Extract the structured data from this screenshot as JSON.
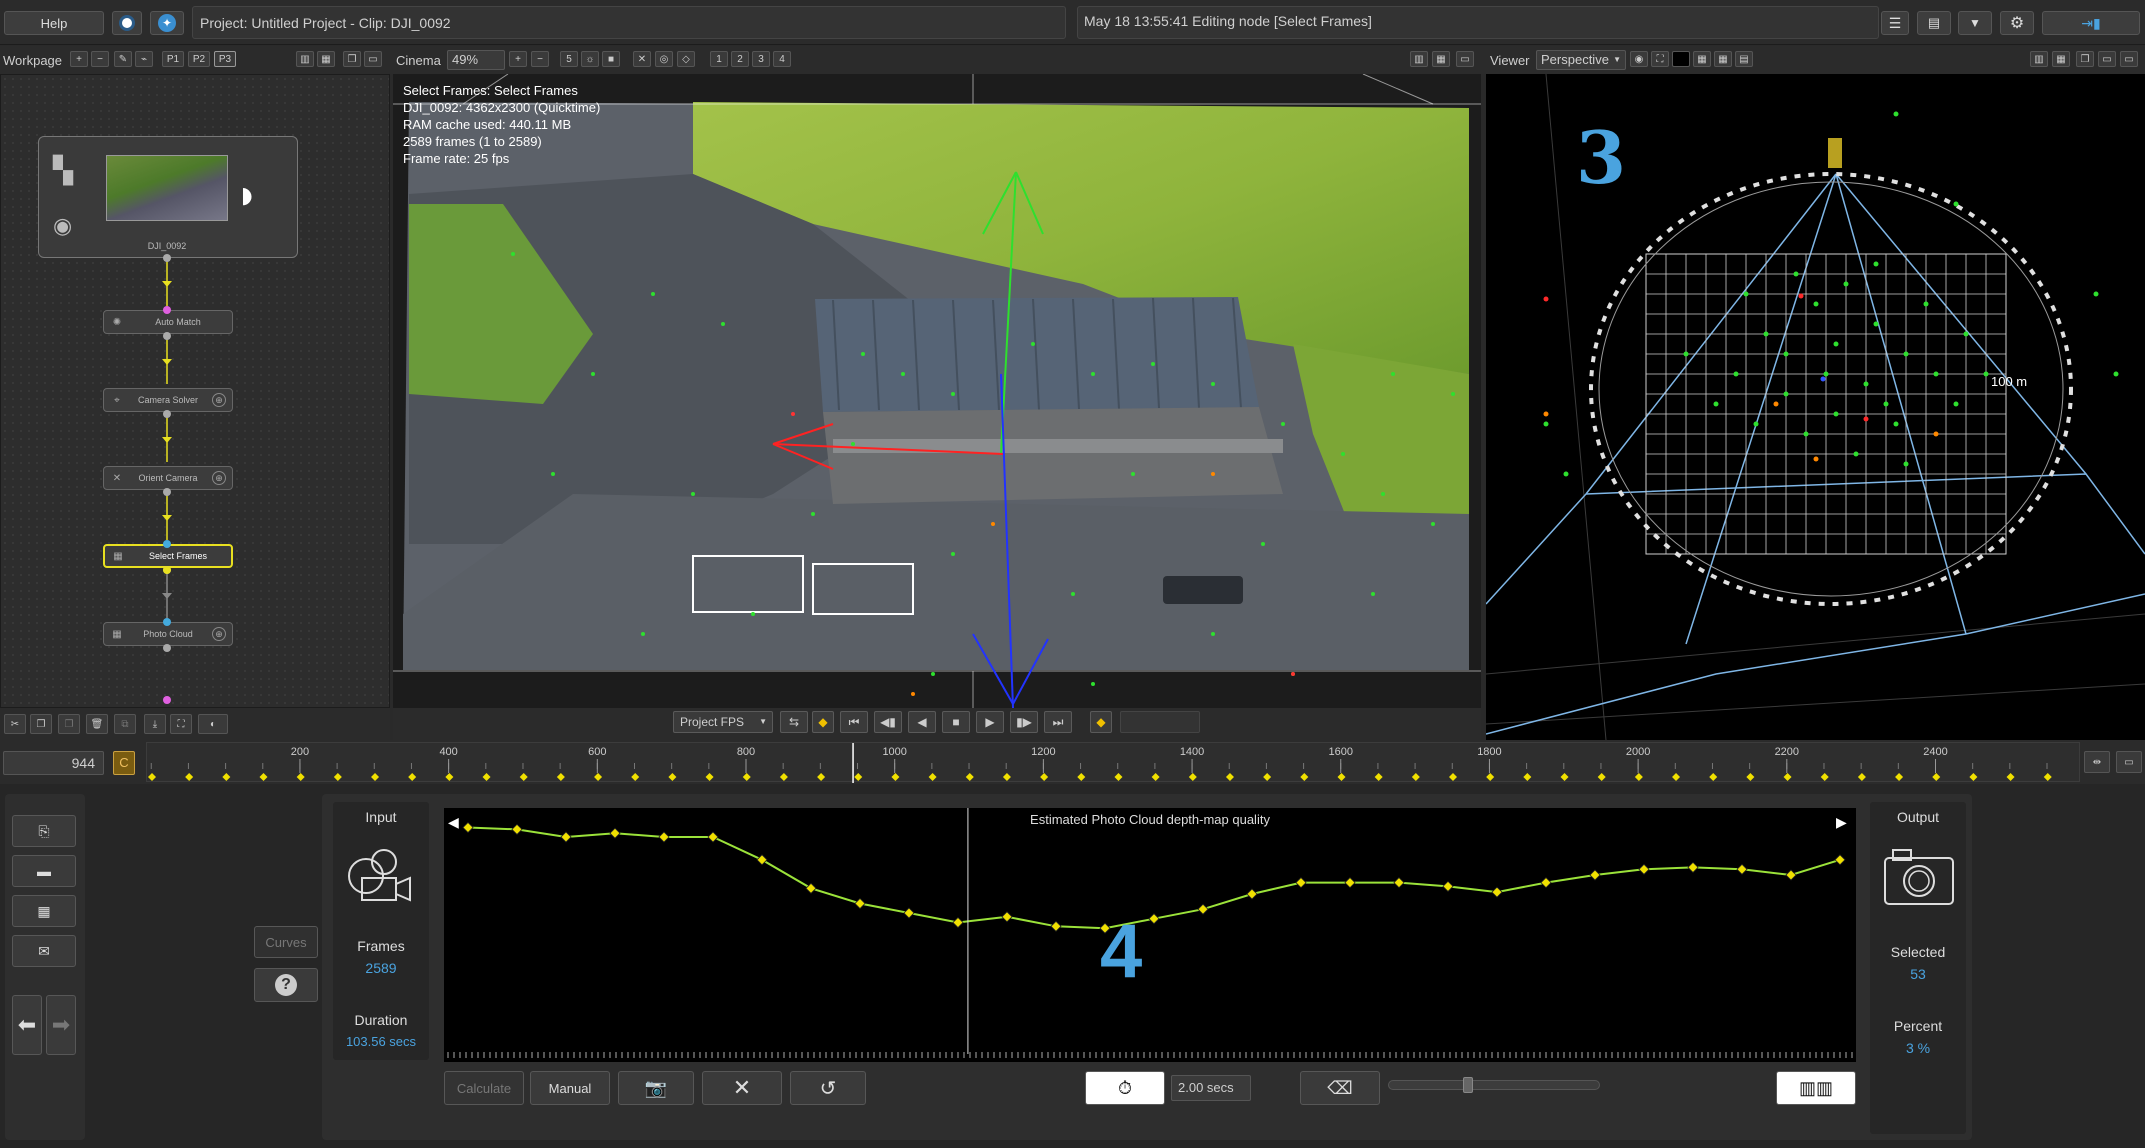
{
  "topbar": {
    "help_label": "Help",
    "project_title": "Project: Untitled Project - Clip: DJI_0092",
    "status_message": "May 18 13:55:41 Editing node [Select Frames]"
  },
  "workpage": {
    "label": "Workpage",
    "pages": [
      "P1",
      "P2",
      "P3"
    ]
  },
  "cinema": {
    "label": "Cinema",
    "zoom": "49%",
    "view_numbers": [
      "1",
      "2",
      "3",
      "4"
    ],
    "info_lines": [
      "Select Frames: Select Frames",
      "DJI_0092: 4362x2300 (Quicktime)",
      "RAM cache used: 440.11 MB",
      "2589 frames (1 to 2589)",
      "Frame rate: 25 fps"
    ]
  },
  "viewer": {
    "label": "Viewer",
    "mode": "Perspective",
    "overlay_number": "3",
    "scale_label": "100 m"
  },
  "nodes": {
    "source_name": "DJI_0092",
    "items": [
      "Auto Match",
      "Camera Solver",
      "Orient Camera",
      "Select Frames",
      "Photo Cloud"
    ]
  },
  "playback": {
    "fps_mode": "Project FPS"
  },
  "timeline": {
    "current_frame": "944",
    "cache_label": "C",
    "ticks": [
      "200",
      "400",
      "600",
      "800",
      "1000",
      "1200",
      "1400",
      "1600",
      "1800",
      "2000",
      "2200",
      "2400"
    ],
    "tick_values": [
      200,
      400,
      600,
      800,
      1000,
      1200,
      1400,
      1600,
      1800,
      2000,
      2200,
      2400
    ],
    "frame_range": [
      1,
      2589
    ],
    "current_frame_value": 944
  },
  "left_panel": {
    "curves_label": "Curves",
    "help_icon": "?"
  },
  "input_panel": {
    "title": "Input",
    "frames_label": "Frames",
    "frames_value": "2589",
    "duration_label": "Duration",
    "duration_value": "103.56 secs"
  },
  "graph": {
    "title": "Estimated Photo Cloud depth-map quality",
    "overlay_number": "4",
    "quality_values": [
      0.95,
      0.94,
      0.9,
      0.92,
      0.9,
      0.9,
      0.78,
      0.63,
      0.55,
      0.5,
      0.45,
      0.48,
      0.43,
      0.42,
      0.47,
      0.52,
      0.6,
      0.66,
      0.66,
      0.66,
      0.64,
      0.61,
      0.66,
      0.7,
      0.73,
      0.74,
      0.73,
      0.7,
      0.78
    ]
  },
  "controls": {
    "calculate_label": "Calculate",
    "manual_label": "Manual",
    "interval_value": "2.00 secs"
  },
  "output_panel": {
    "title": "Output",
    "selected_label": "Selected",
    "selected_value": "53",
    "percent_label": "Percent",
    "percent_value": "3 %"
  },
  "colors": {
    "accent_blue": "#4aa3df",
    "selected_yellow": "#e8e020",
    "curve_green": "#9be23a",
    "keyframe_yellow": "#f0e000"
  }
}
